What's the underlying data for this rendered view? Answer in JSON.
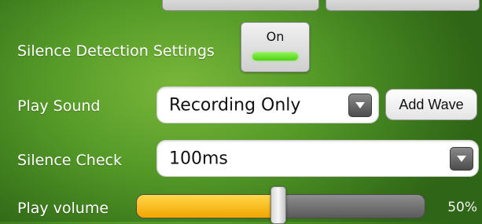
{
  "settings": {
    "silence_detection": {
      "label": "Silence Detection Settings",
      "toggle_label": "On",
      "enabled": true
    },
    "play_sound": {
      "label": "Play Sound",
      "selected": "Recording Only",
      "add_wave_label": "Add Wave"
    },
    "silence_check": {
      "label": "Silence Check",
      "selected": "100ms"
    },
    "play_volume": {
      "label": "Play volume",
      "value": 50,
      "display": "50%"
    }
  },
  "colors": {
    "background": "#559a28",
    "toggle_on": "#5fe022",
    "slider_fill": "#f7b800"
  },
  "icons": {
    "dropdown": "chevron-down-icon"
  }
}
